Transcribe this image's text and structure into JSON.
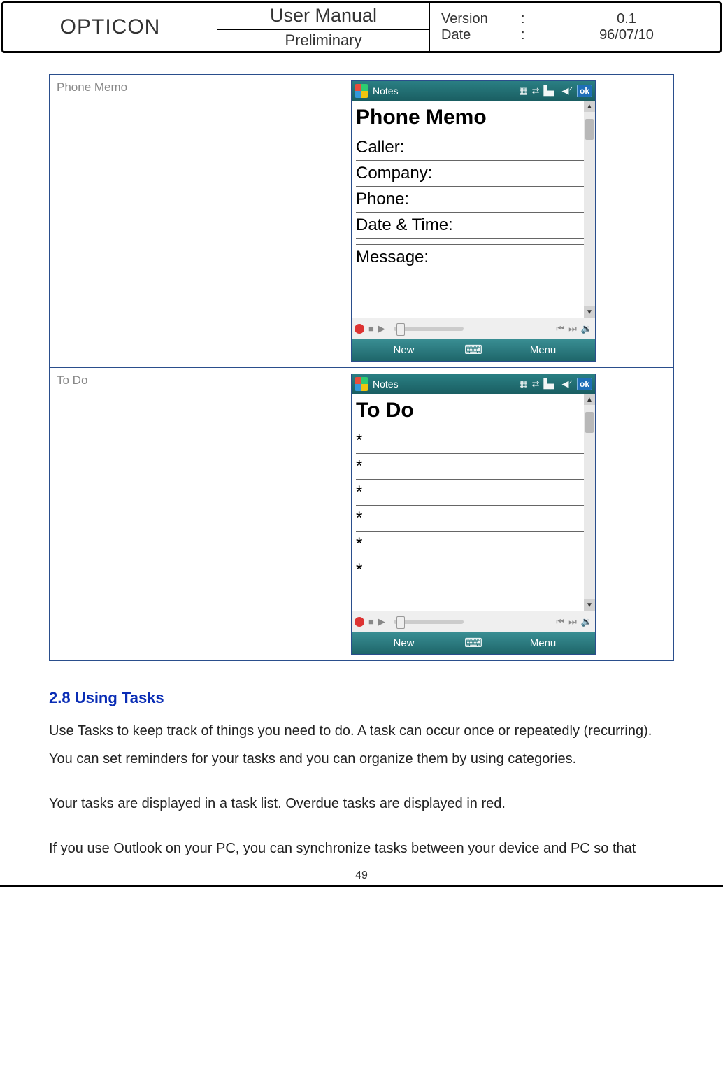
{
  "header": {
    "brand": "OPTICON",
    "title_main": "User Manual",
    "title_sub": "Preliminary",
    "version_label": "Version",
    "version_value": "0.1",
    "date_label": "Date",
    "date_value": "96/07/10",
    "colon": ":"
  },
  "rows": [
    {
      "label": "Phone Memo",
      "device": {
        "status_app": "Notes",
        "ok": "ok",
        "title": "Phone Memo",
        "lines": [
          "Caller:",
          "Company:",
          "Phone:",
          "Date & Time:",
          "",
          "Message:"
        ],
        "soft_left": "New",
        "soft_right": "Menu"
      }
    },
    {
      "label": "To Do",
      "device": {
        "status_app": "Notes",
        "ok": "ok",
        "title": "To Do",
        "lines": [
          "*",
          "*",
          "*",
          "*",
          "*",
          "*"
        ],
        "soft_left": "New",
        "soft_right": "Menu"
      }
    }
  ],
  "section": {
    "heading": "2.8 Using Tasks",
    "p1": "Use Tasks to keep track of things you need to do. A task can occur once or repeatedly (recurring). You can set reminders for your tasks and you can organize them by using categories.",
    "p2": "Your tasks are displayed in a task list. Overdue tasks are displayed in red.",
    "p3": "If you use Outlook on your PC, you can synchronize tasks between your device and PC so that"
  },
  "page_number": "49"
}
